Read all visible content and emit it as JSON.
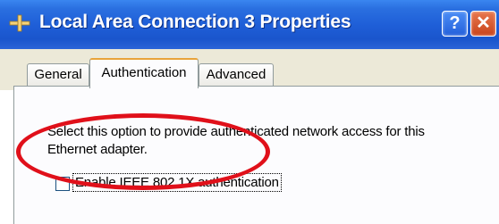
{
  "window": {
    "title": "Local Area Connection 3 Properties",
    "help_button": "?",
    "close_button": "✕",
    "icon": "network-connection-icon"
  },
  "tabs": [
    {
      "label": "General",
      "selected": false
    },
    {
      "label": "Authentication",
      "selected": true
    },
    {
      "label": "Advanced",
      "selected": false
    }
  ],
  "authentication": {
    "description": "Select this option to provide authenticated network access for this Ethernet adapter.",
    "enable_8021x": {
      "label": "Enable IEEE 802.1X authentication",
      "checked": false
    }
  },
  "annotation": {
    "shape": "ellipse",
    "color": "#e0101a"
  },
  "colors": {
    "titlebar": "#1f5fd8",
    "tab_highlight": "#e8a33a",
    "dialog_bg": "#ece9d8"
  }
}
